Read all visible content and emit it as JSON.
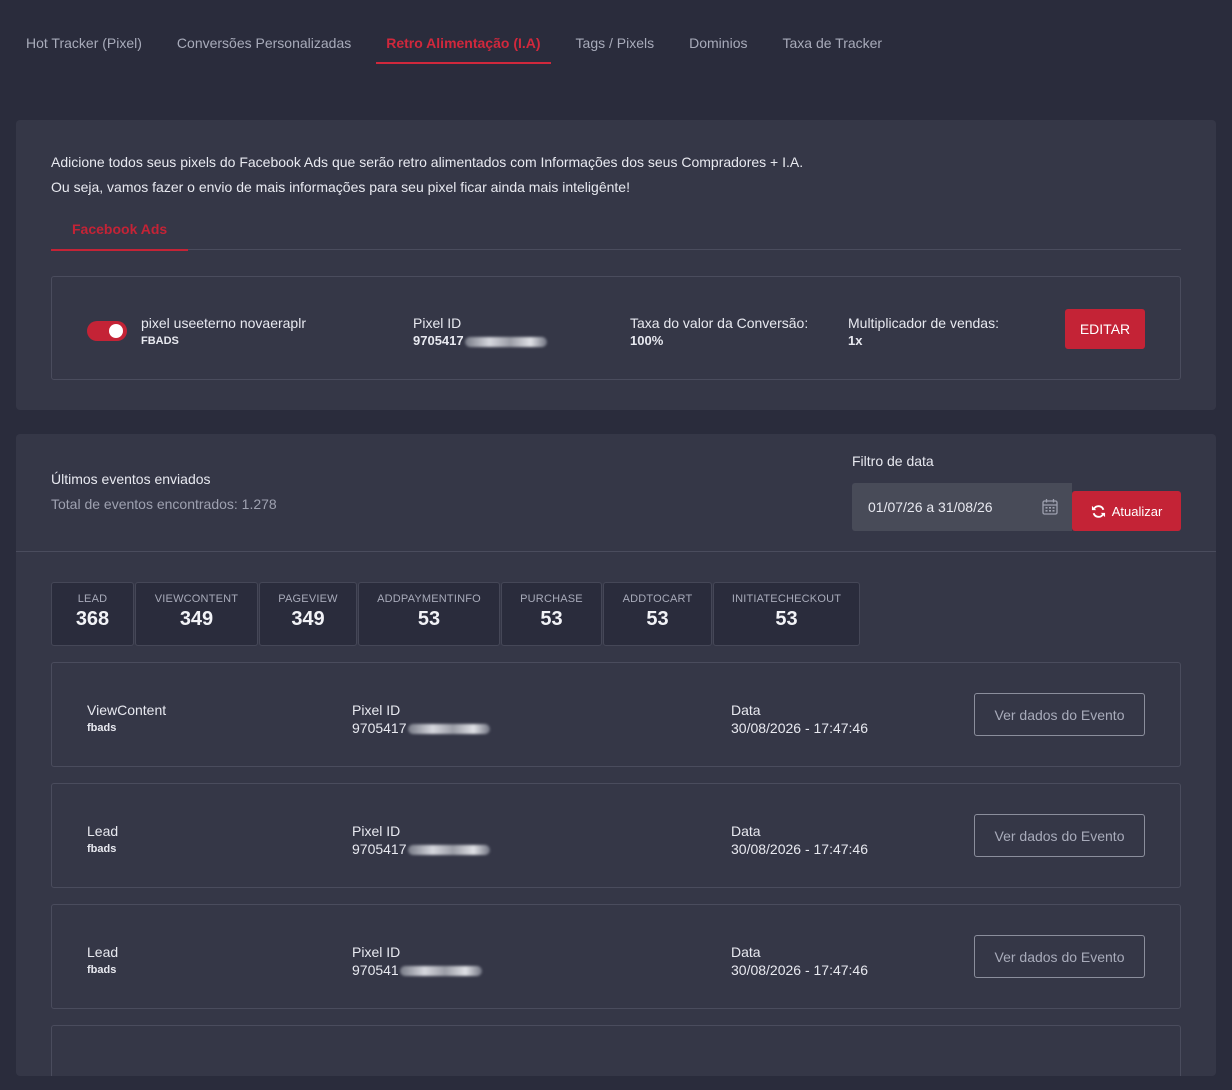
{
  "nav": {
    "tabs": [
      {
        "label": "Hot Tracker (Pixel)"
      },
      {
        "label": "Conversões Personalizadas"
      },
      {
        "label": "Retro Alimentação (I.A)"
      },
      {
        "label": "Tags / Pixels"
      },
      {
        "label": "Dominios"
      },
      {
        "label": "Taxa de Tracker"
      }
    ],
    "active_index": 2
  },
  "intro": {
    "line1": "Adicione todos seus pixels do Facebook Ads que serão retro alimentados com Informações dos seus Compradores + I.A.",
    "line2": "Ou seja, vamos fazer o envio de mais informações para seu pixel ficar ainda mais inteligênte!"
  },
  "subtab": {
    "label": "Facebook Ads"
  },
  "pixel": {
    "enabled": true,
    "name": "pixel useeterno novaeraplr",
    "type": "FBADS",
    "id_label": "Pixel ID",
    "id_value": "9705417",
    "rate_label": "Taxa do valor da Conversão:",
    "rate_value": "100%",
    "mult_label": "Multiplicador de vendas:",
    "mult_value": "1x",
    "edit_label": "EDITAR"
  },
  "events": {
    "title": "Últimos eventos enviados",
    "total": "Total de eventos encontrados: 1.278",
    "filter_label": "Filtro de data",
    "date_range": "01/07/26 a 31/08/26",
    "update_label": "Atualizar",
    "stats": [
      {
        "label": "LEAD",
        "value": "368"
      },
      {
        "label": "VIEWCONTENT",
        "value": "349"
      },
      {
        "label": "PAGEVIEW",
        "value": "349"
      },
      {
        "label": "ADDPAYMENTINFO",
        "value": "53"
      },
      {
        "label": "PURCHASE",
        "value": "53"
      },
      {
        "label": "ADDTOCART",
        "value": "53"
      },
      {
        "label": "INITIATECHECKOUT",
        "value": "53"
      }
    ],
    "rows": [
      {
        "name": "ViewContent",
        "source": "fbads",
        "pixel_label": "Pixel ID",
        "pixel_value": "9705417",
        "date_label": "Data",
        "date_value": "30/08/2026 - 17:47:46",
        "button": "Ver dados do Evento"
      },
      {
        "name": "Lead",
        "source": "fbads",
        "pixel_label": "Pixel ID",
        "pixel_value": "9705417",
        "date_label": "Data",
        "date_value": "30/08/2026 - 17:47:46",
        "button": "Ver dados do Evento"
      },
      {
        "name": "Lead",
        "source": "fbads",
        "pixel_label": "Pixel ID",
        "pixel_value": "970541",
        "date_label": "Data",
        "date_value": "30/08/2026 - 17:47:46",
        "button": "Ver dados do Evento"
      }
    ]
  }
}
